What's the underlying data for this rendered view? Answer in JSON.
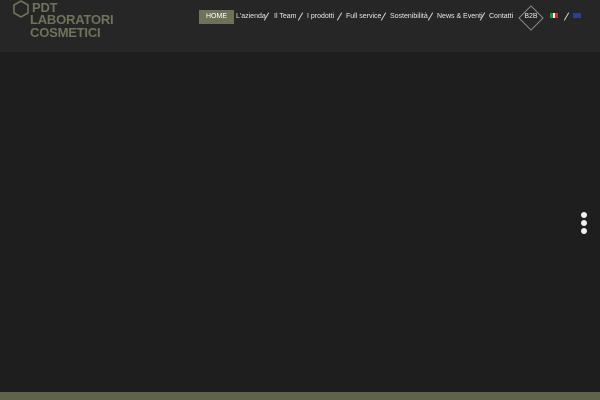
{
  "logo": {
    "line1": "PDT",
    "line2": "LABORATORI",
    "line3": "COSMETICI",
    "color": "#6e7359"
  },
  "nav": {
    "items": [
      {
        "label": "HOME",
        "active": true
      },
      {
        "label": "L'azienda"
      },
      {
        "label": "Il Team"
      },
      {
        "label": "I prodotti"
      },
      {
        "label": "Full service"
      },
      {
        "label": "Sostenibilità"
      },
      {
        "label": "News & Eventi"
      },
      {
        "label": "Contatti"
      }
    ],
    "b2b_label": "B2B",
    "active_color": "#6d7259"
  },
  "languages": [
    {
      "code": "it",
      "icon": "italy-flag-icon"
    },
    {
      "code": "en",
      "icon": "uk-flag-icon"
    }
  ],
  "colors": {
    "background": "#1e1e1e",
    "header": "#262626",
    "accent": "#5f6349"
  },
  "slider": {
    "dots": 3
  }
}
